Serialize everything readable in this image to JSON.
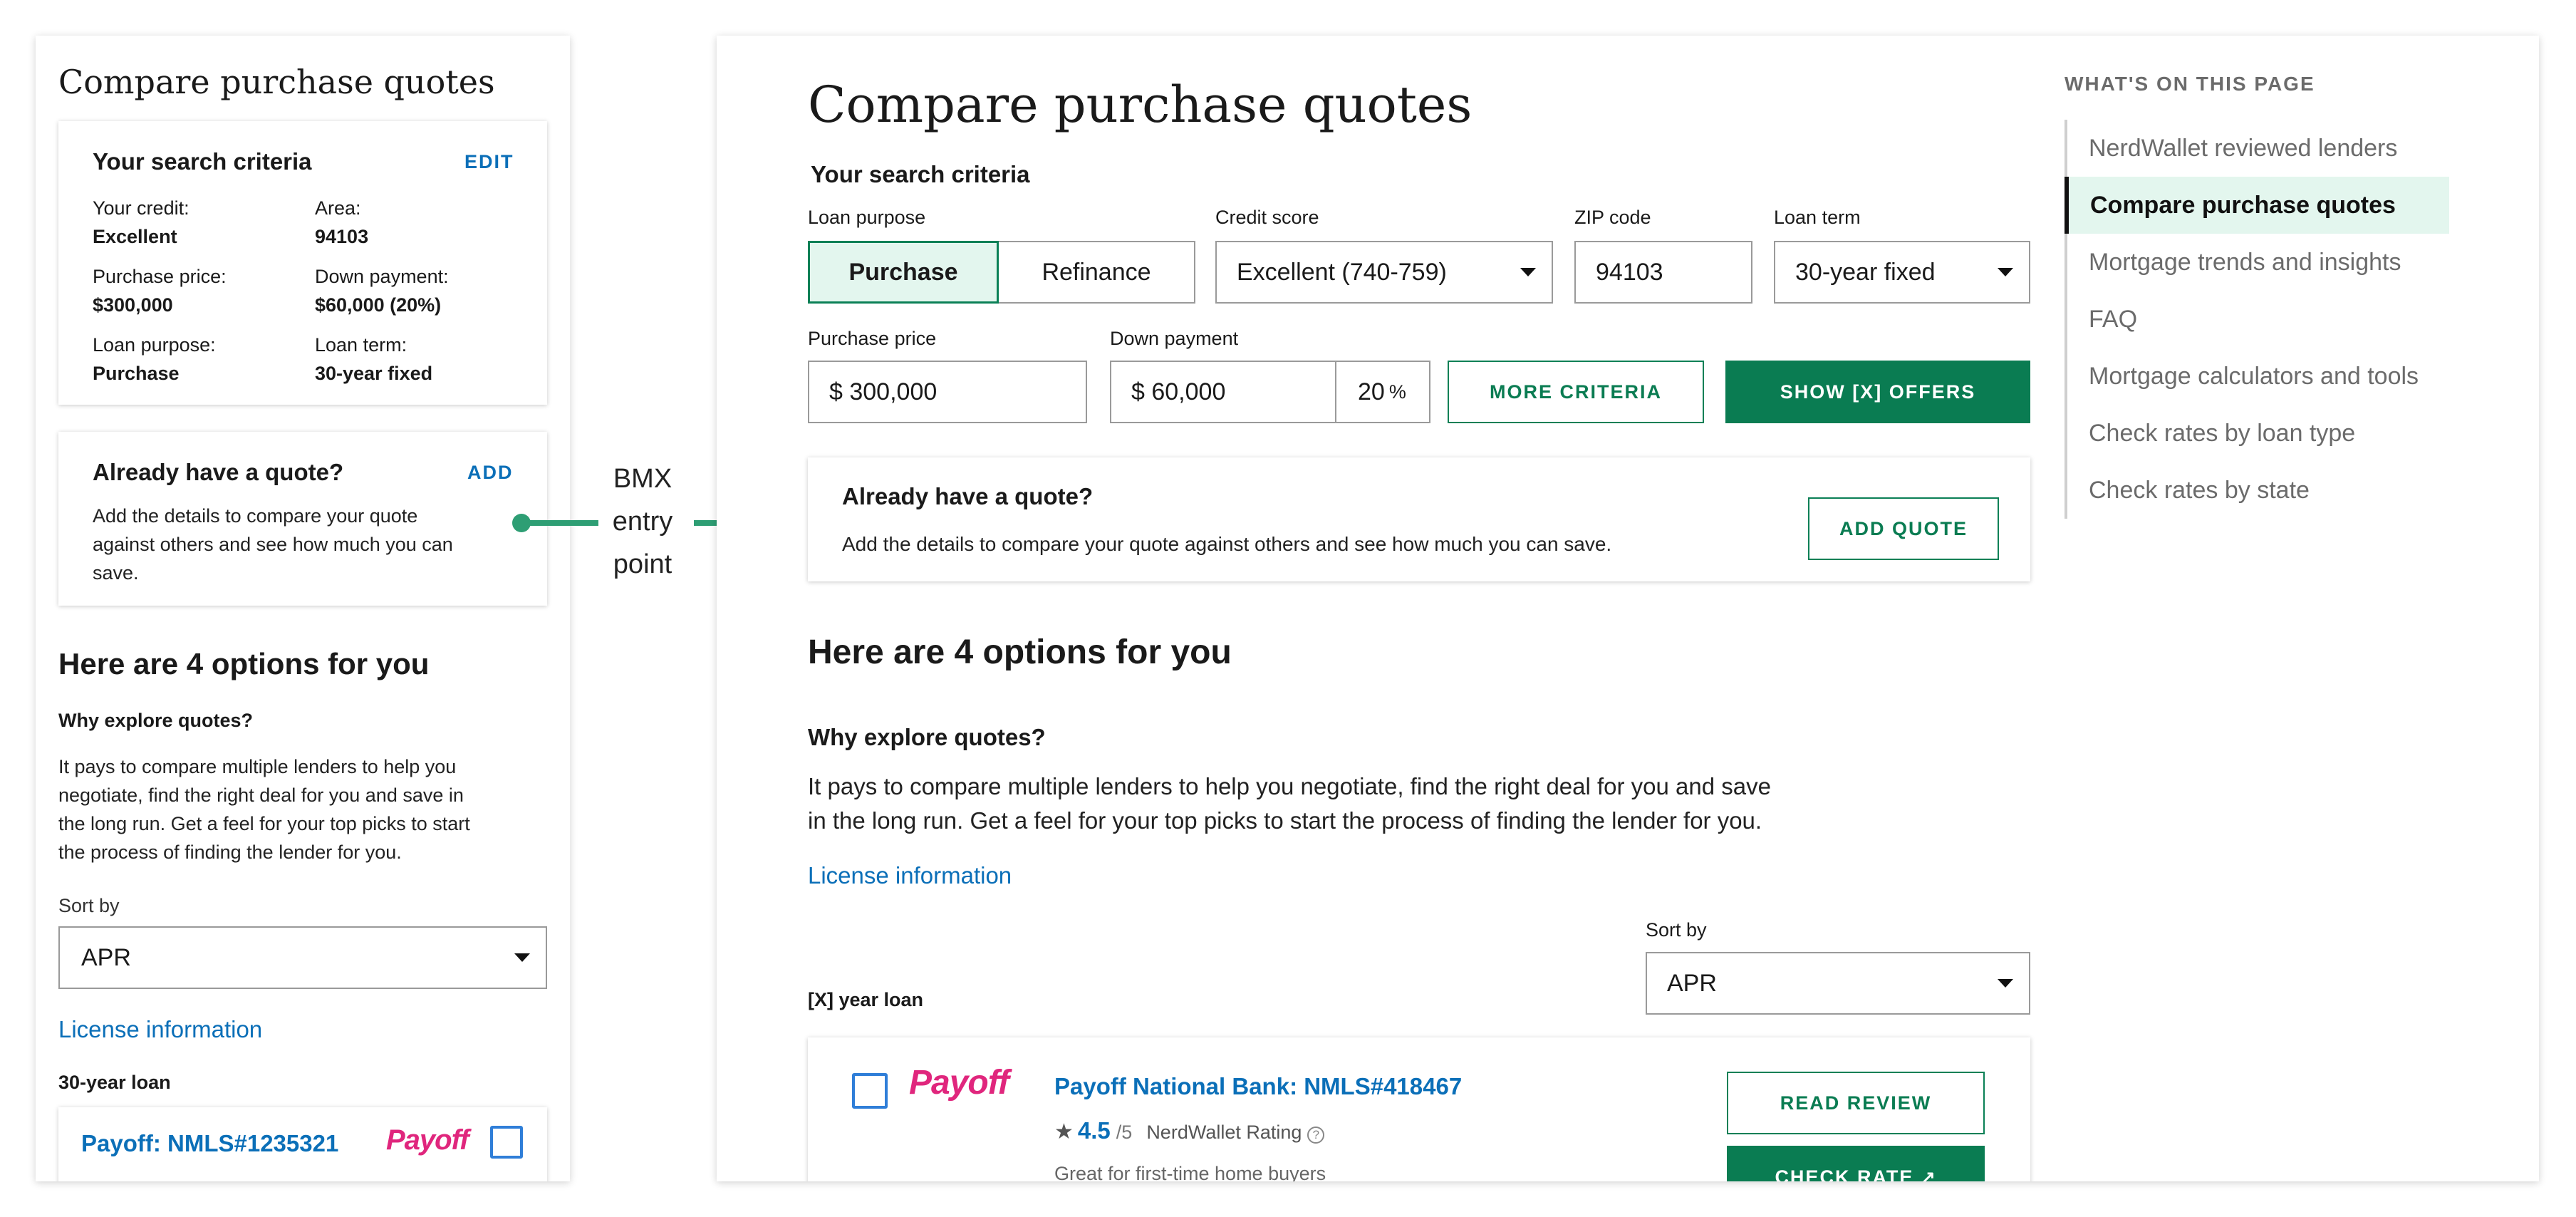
{
  "mobile": {
    "page_title": "Compare purchase quotes",
    "criteria": {
      "heading": "Your search criteria",
      "edit_label": "EDIT",
      "items": [
        {
          "label": "Your credit:",
          "value": "Excellent"
        },
        {
          "label": "Area:",
          "value": "94103"
        },
        {
          "label": "Purchase price:",
          "value": "$300,000"
        },
        {
          "label": "Down payment:",
          "value": "$60,000 (20%)"
        },
        {
          "label": "Loan purpose:",
          "value": "Purchase"
        },
        {
          "label": "Loan term:",
          "value": "30-year fixed"
        }
      ]
    },
    "quote_card": {
      "heading": "Already have a quote?",
      "add_label": "ADD",
      "body_lines": [
        "Add the details to compare your quote",
        "against others and see how much you can",
        "save."
      ]
    },
    "options_heading": "Here are 4 options for you",
    "why_heading": "Why explore quotes?",
    "why_lines": [
      "It pays to compare multiple lenders to help you",
      "negotiate, find the right deal for you and save in",
      "the long run. Get a feel for your top picks to start",
      "the process of finding the lender for you."
    ],
    "sort_label": "Sort by",
    "sort_value": "APR",
    "license_link": "License information",
    "loan_label": "30-year loan",
    "lender_name": "Payoff: NMLS#1235321",
    "lender_logo": "Payoff"
  },
  "annotation": {
    "lines": [
      "BMX",
      "entry",
      "point"
    ],
    "color": "#2e9e74"
  },
  "desktop": {
    "page_title": "Compare purchase quotes",
    "criteria_heading": "Your search criteria",
    "labels": {
      "loan_purpose": "Loan purpose",
      "credit_score": "Credit score",
      "zip": "ZIP code",
      "loan_term": "Loan term",
      "purchase_price": "Purchase price",
      "down_payment": "Down payment"
    },
    "purpose_options": {
      "purchase": "Purchase",
      "refinance": "Refinance"
    },
    "credit_value": "Excellent (740-759)",
    "zip_value": "94103",
    "term_value": "30-year fixed",
    "price_value": "$ 300,000",
    "down_value": "$ 60,000",
    "down_pct": "20",
    "pct_sign": "%",
    "more_criteria": "MORE CRITERIA",
    "show_offers": "SHOW [X] OFFERS",
    "quote_card": {
      "heading": "Already have a quote?",
      "body": "Add the details to compare your quote against others and see how much you can save.",
      "button": "ADD QUOTE"
    },
    "options_heading": "Here are 4 options for you",
    "why_heading": "Why explore quotes?",
    "why_lines": [
      "It pays to compare multiple lenders to help you negotiate, find the right deal for you and save",
      "in the long run. Get a feel for your top picks to start the process of finding the lender for you."
    ],
    "license_link": "License information",
    "sort_label": "Sort by",
    "sort_value": "APR",
    "loan_label": "[X] year loan",
    "lender": {
      "logo": "Payoff",
      "name": "Payoff National Bank: NMLS#418467",
      "rating": "4.5",
      "rating_max": "/5",
      "rating_label": "NerdWallet Rating",
      "tagline": "Great for first-time home buyers",
      "read_review": "READ REVIEW",
      "check_rate": "CHECK RATE"
    }
  },
  "toc": {
    "heading": "WHAT'S ON THIS PAGE",
    "items": [
      "NerdWallet reviewed lenders",
      "Compare purchase quotes",
      "Mortgage trends and insights",
      "FAQ",
      "Mortgage calculators and tools",
      "Check rates by loan type",
      "Check rates by state"
    ],
    "active_index": 1
  },
  "colors": {
    "brand_green": "#0a7c52",
    "link_blue": "#0b6fb8",
    "payoff_pink": "#e0267d",
    "toc_active_bg": "#e3f6ee"
  }
}
